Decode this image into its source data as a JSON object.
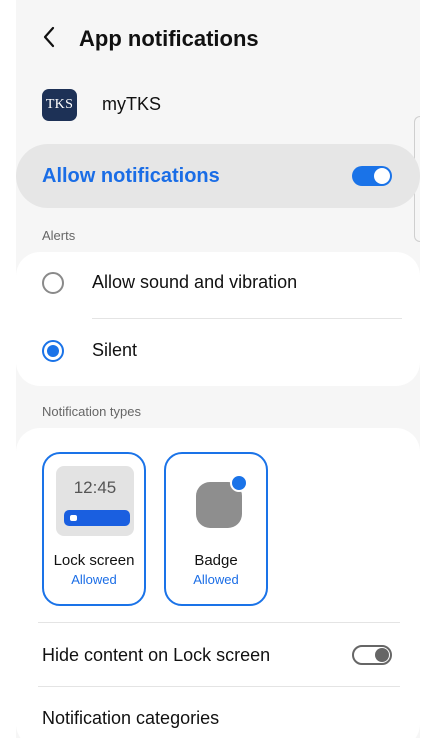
{
  "header": {
    "back_icon": "chevron-left-icon",
    "title": "App notifications"
  },
  "app": {
    "icon_text": "TKS",
    "name": "myTKS",
    "icon_color": "#1d3156"
  },
  "allow": {
    "label": "Allow notifications",
    "enabled": true
  },
  "alerts": {
    "section_label": "Alerts",
    "options": [
      {
        "label": "Allow sound and vibration",
        "selected": false
      },
      {
        "label": "Silent",
        "selected": true
      }
    ]
  },
  "notification_types": {
    "section_label": "Notification types",
    "lock_screen": {
      "preview_time": "12:45",
      "name": "Lock screen",
      "status": "Allowed",
      "selected": true
    },
    "badge": {
      "name": "Badge",
      "status": "Allowed",
      "selected": true
    }
  },
  "hide_content": {
    "label": "Hide content on Lock screen",
    "enabled": false
  },
  "categories": {
    "label": "Notification categories"
  },
  "colors": {
    "accent": "#1a73e8",
    "background": "#f6f6f6",
    "card": "#ffffff"
  }
}
